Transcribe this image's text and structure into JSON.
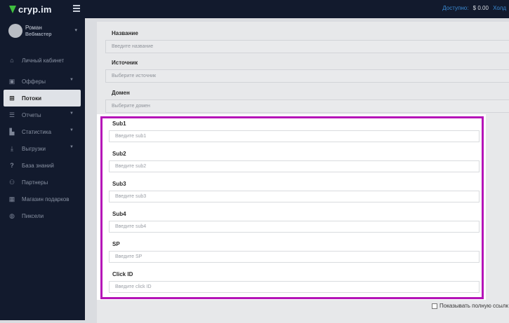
{
  "header": {
    "logo_text": "cryp.im",
    "balance_label": "Доступно:",
    "balance_value": "$ 0.00",
    "hold_label": "Холд"
  },
  "user": {
    "name": "Роман",
    "role": "Вебмастер"
  },
  "sidebar": {
    "items": [
      {
        "label": "Личный кабинет",
        "icon": "home-icon"
      },
      {
        "label": "Офферы",
        "icon": "basket-icon"
      },
      {
        "label": "Потоки",
        "icon": "sitemap-icon"
      },
      {
        "label": "Отчеты",
        "icon": "list-icon"
      },
      {
        "label": "Статистика",
        "icon": "chart-icon"
      },
      {
        "label": "Выгрузки",
        "icon": "download-icon"
      },
      {
        "label": "База знаний",
        "icon": "question-icon"
      },
      {
        "label": "Партнеры",
        "icon": "handshake-icon"
      },
      {
        "label": "Магазин подарков",
        "icon": "gift-icon"
      },
      {
        "label": "Пиксели",
        "icon": "globe-icon"
      }
    ]
  },
  "form_top": {
    "name": {
      "label": "Название",
      "placeholder": "Введите название"
    },
    "source": {
      "label": "Источник",
      "placeholder": "Выберите источник"
    },
    "domain": {
      "label": "Домен",
      "placeholder": "Выберите домен"
    }
  },
  "subs": {
    "sub1": {
      "label": "Sub1",
      "placeholder": "Введите sub1"
    },
    "sub2": {
      "label": "Sub2",
      "placeholder": "Введите sub2"
    },
    "sub3": {
      "label": "Sub3",
      "placeholder": "Введите sub3"
    },
    "sub4": {
      "label": "Sub4",
      "placeholder": "Введите sub4"
    },
    "sp": {
      "label": "SP",
      "placeholder": "Введите SP"
    },
    "click_id": {
      "label": "Click ID",
      "placeholder": "Введите click ID"
    }
  },
  "show_full_link_label": "Показывать полную ссылк",
  "colors": {
    "sidebar_bg": "#121a2d",
    "highlight_border": "#b514b8",
    "logo_green": "#3fbf3f",
    "link_blue": "#3a8bd4"
  }
}
